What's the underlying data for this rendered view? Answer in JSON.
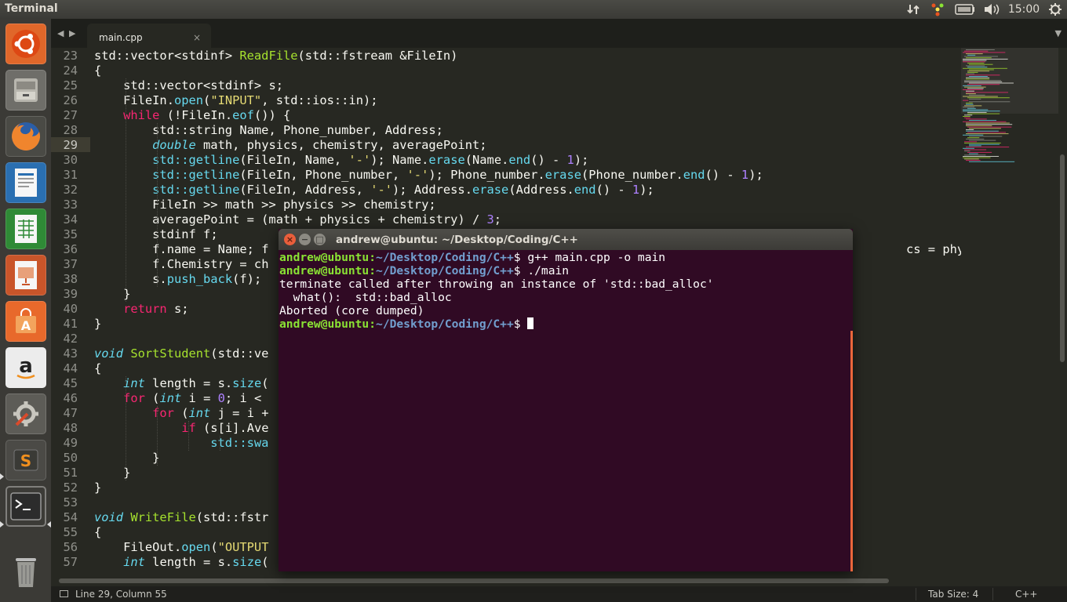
{
  "top_panel": {
    "app_title": "Terminal",
    "clock": "15:00",
    "tray_icons": [
      "network-transfer-icon",
      "multi-color-indicator-icon",
      "battery-icon",
      "volume-icon",
      "session-gear-icon"
    ]
  },
  "launcher": {
    "items": [
      {
        "name": "ubuntu-dash",
        "icon": "ubuntu-logo-icon"
      },
      {
        "name": "files",
        "icon": "file-cabinet-icon"
      },
      {
        "name": "firefox",
        "icon": "firefox-icon"
      },
      {
        "name": "libreoffice-writer",
        "icon": "writer-document-icon"
      },
      {
        "name": "libreoffice-calc",
        "icon": "calc-spreadsheet-icon"
      },
      {
        "name": "libreoffice-impress",
        "icon": "impress-presentation-icon"
      },
      {
        "name": "ubuntu-software-center",
        "icon": "shopping-bag-icon"
      },
      {
        "name": "amazon",
        "icon": "amazon-icon"
      },
      {
        "name": "system-settings",
        "icon": "settings-wrench-icon"
      },
      {
        "name": "sublime-text",
        "icon": "sublime-text-icon"
      },
      {
        "name": "terminal",
        "icon": "terminal-prompt-icon"
      },
      {
        "name": "trash",
        "icon": "trash-icon"
      }
    ]
  },
  "editor": {
    "tab": {
      "label": "main.cpp",
      "close": "×"
    },
    "nav_prev": "◀",
    "nav_next": "▶",
    "tab_menu": "▼",
    "active_line": "29",
    "line_numbers": [
      "23",
      "24",
      "25",
      "26",
      "27",
      "28",
      "29",
      "30",
      "31",
      "32",
      "33",
      "34",
      "35",
      "36",
      "37",
      "38",
      "39",
      "40",
      "41",
      "42",
      "43",
      "44",
      "45",
      "46",
      "47",
      "48",
      "49",
      "50",
      "51",
      "52",
      "53",
      "54",
      "55",
      "56",
      "57"
    ],
    "code_lines": [
      "std::vector<stdinf> ReadFile(std::fstream &FileIn)",
      "{",
      "    std::vector<stdinf> s;",
      "    FileIn.open(\"INPUT\", std::ios::in);",
      "    while (!FileIn.eof()) {",
      "        std::string Name, Phone_number, Address;",
      "        double math, physics, chemistry, averagePoint;",
      "        std::getline(FileIn, Name, '-'); Name.erase(Name.end() - 1);",
      "        std::getline(FileIn, Phone_number, '-'); Phone_number.erase(Phone_number.end() - 1);",
      "        std::getline(FileIn, Address, '-'); Address.erase(Address.end() - 1);",
      "        FileIn >> math >> physics >> chemistry;",
      "        averagePoint = (math + physics + chemistry) / 3;",
      "        stdinf f;",
      "        f.name = Name; f",
      "        f.Chemistry = ch",
      "        s.push_back(f);",
      "    }",
      "    return s;",
      "}",
      "",
      "void SortStudent(std::ve",
      "{",
      "    int length = s.size(",
      "    for (int i = 0; i < ",
      "        for (int j = i + ",
      "            if (s[i].Ave",
      "                std::swa",
      "        }",
      "    }",
      "}",
      "",
      "void WriteFile(std::fstr",
      "{",
      "    FileOut.open(\"OUTPUT",
      "    int length = s.size("
    ],
    "overflow_fragment_36": "cs = physics;"
  },
  "status_bar": {
    "position": "Line 29, Column 55",
    "tab_size": "Tab Size: 4",
    "syntax": "C++"
  },
  "terminal": {
    "title": "andrew@ubuntu: ~/Desktop/Coding/C++",
    "prompt_user": "andrew@ubuntu",
    "prompt_path": "~/Desktop/Coding/C++",
    "lines": [
      {
        "kind": "prompt",
        "command": " g++ main.cpp -o main"
      },
      {
        "kind": "prompt",
        "command": " ./main"
      },
      {
        "kind": "output",
        "text": "terminate called after throwing an instance of 'std::bad_alloc'"
      },
      {
        "kind": "output",
        "text": "  what():  std::bad_alloc"
      },
      {
        "kind": "output",
        "text": "Aborted (core dumped)"
      },
      {
        "kind": "prompt",
        "command": " "
      }
    ]
  },
  "colors": {
    "editor_bg": "#272822",
    "keyword": "#f92672",
    "type_italic": "#66d9ef",
    "function_green": "#a6e22e",
    "string_yellow": "#e6db74",
    "number_purple": "#ae81ff",
    "terminal_bg": "#300a24",
    "prompt_green": "#8ae234",
    "prompt_blue": "#729fcf"
  }
}
